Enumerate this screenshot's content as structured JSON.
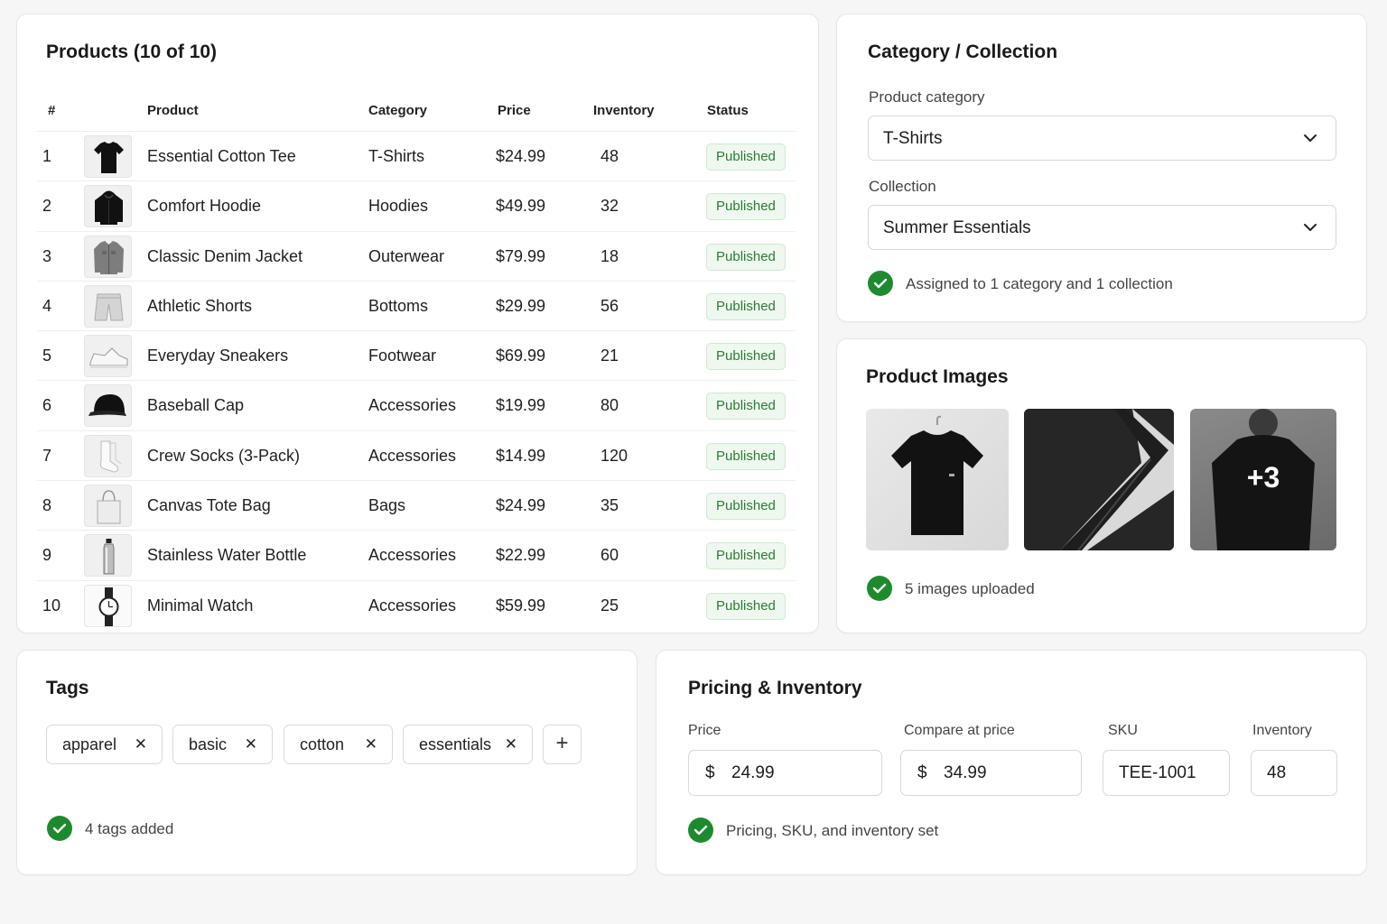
{
  "products": {
    "title": "Products (10 of 10)",
    "columns": [
      "#",
      "Product",
      "Category",
      "Price",
      "Inventory",
      "Status"
    ],
    "rows": [
      {
        "num": "1",
        "name": "Essential Cotton Tee",
        "category": "T-Shirts",
        "price": "$24.99",
        "inventory": "48",
        "status": "Published",
        "thumb": "tshirt-icon"
      },
      {
        "num": "2",
        "name": "Comfort Hoodie",
        "category": "Hoodies",
        "price": "$49.99",
        "inventory": "32",
        "status": "Published",
        "thumb": "hoodie-icon"
      },
      {
        "num": "3",
        "name": "Classic Denim Jacket",
        "category": "Outerwear",
        "price": "$79.99",
        "inventory": "18",
        "status": "Published",
        "thumb": "jacket-icon"
      },
      {
        "num": "4",
        "name": "Athletic Shorts",
        "category": "Bottoms",
        "price": "$29.99",
        "inventory": "56",
        "status": "Published",
        "thumb": "shorts-icon"
      },
      {
        "num": "5",
        "name": "Everyday Sneakers",
        "category": "Footwear",
        "price": "$69.99",
        "inventory": "21",
        "status": "Published",
        "thumb": "sneaker-icon"
      },
      {
        "num": "6",
        "name": "Baseball Cap",
        "category": "Accessories",
        "price": "$19.99",
        "inventory": "80",
        "status": "Published",
        "thumb": "cap-icon"
      },
      {
        "num": "7",
        "name": "Crew Socks (3-Pack)",
        "category": "Accessories",
        "price": "$14.99",
        "inventory": "120",
        "status": "Published",
        "thumb": "socks-icon"
      },
      {
        "num": "8",
        "name": "Canvas Tote Bag",
        "category": "Bags",
        "price": "$24.99",
        "inventory": "35",
        "status": "Published",
        "thumb": "tote-bag-icon"
      },
      {
        "num": "9",
        "name": "Stainless Water Bottle",
        "category": "Accessories",
        "price": "$22.99",
        "inventory": "60",
        "status": "Published",
        "thumb": "bottle-icon"
      },
      {
        "num": "10",
        "name": "Minimal Watch",
        "category": "Accessories",
        "price": "$59.99",
        "inventory": "25",
        "status": "Published",
        "thumb": "watch-icon"
      }
    ]
  },
  "category": {
    "title": "Category / Collection",
    "category_label": "Product category",
    "category_value": "T-Shirts",
    "collection_label": "Collection",
    "collection_value": "Summer Essentials",
    "status_text": "Assigned to 1 category and 1 collection"
  },
  "images": {
    "title": "Product Images",
    "more_count": "+3",
    "status_text": "5 images uploaded"
  },
  "tags": {
    "title": "Tags",
    "items": [
      "apparel",
      "basic",
      "cotton",
      "essentials"
    ],
    "remove_glyph": "✕",
    "add_glyph": "+",
    "status_text": "4 tags added"
  },
  "pricing": {
    "title": "Pricing & Inventory",
    "price_label": "Price",
    "price_currency": "$",
    "price_value": "24.99",
    "compare_label": "Compare at price",
    "compare_currency": "$",
    "compare_value": "34.99",
    "sku_label": "SKU",
    "sku_value": "TEE-1001",
    "inventory_label": "Inventory",
    "inventory_value": "48",
    "status_text": "Pricing, SKU, and inventory set"
  },
  "colors": {
    "success": "#1e8a2f",
    "badge_text": "#2f7a35",
    "badge_bg": "#eef8ef"
  }
}
